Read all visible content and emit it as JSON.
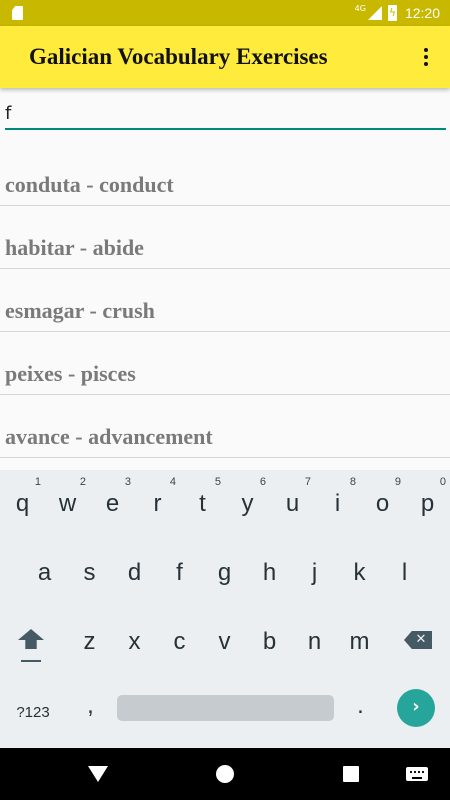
{
  "status_bar": {
    "network": "4G",
    "time": "12:20",
    "icons": [
      "sd-card-icon",
      "signal-icon",
      "battery-charging-icon"
    ]
  },
  "app_bar": {
    "title": "Galician Vocabulary Exercises",
    "menu_icon": "overflow-menu-icon"
  },
  "search": {
    "value": "f"
  },
  "results": [
    {
      "text": "conduta - conduct"
    },
    {
      "text": "habitar - abide"
    },
    {
      "text": "esmagar - crush"
    },
    {
      "text": "peixes - pisces"
    },
    {
      "text": "avance - advancement"
    }
  ],
  "keyboard": {
    "row1": [
      {
        "label": "q",
        "hint": "1"
      },
      {
        "label": "w",
        "hint": "2"
      },
      {
        "label": "e",
        "hint": "3"
      },
      {
        "label": "r",
        "hint": "4"
      },
      {
        "label": "t",
        "hint": "5"
      },
      {
        "label": "y",
        "hint": "6"
      },
      {
        "label": "u",
        "hint": "7"
      },
      {
        "label": "i",
        "hint": "8"
      },
      {
        "label": "o",
        "hint": "9"
      },
      {
        "label": "p",
        "hint": "0"
      }
    ],
    "row2": [
      "a",
      "s",
      "d",
      "f",
      "g",
      "h",
      "j",
      "k",
      "l"
    ],
    "row3": [
      "z",
      "x",
      "c",
      "v",
      "b",
      "n",
      "m"
    ],
    "symbols_key": "?123",
    "comma_key": ",",
    "period_key": ".",
    "enter_icon": "›",
    "backspace_icon": "✕"
  },
  "colors": {
    "app_bar": "#ffeb3b",
    "status_bar": "#c9b800",
    "accent": "#00897b",
    "enter_key": "#26a69a"
  }
}
